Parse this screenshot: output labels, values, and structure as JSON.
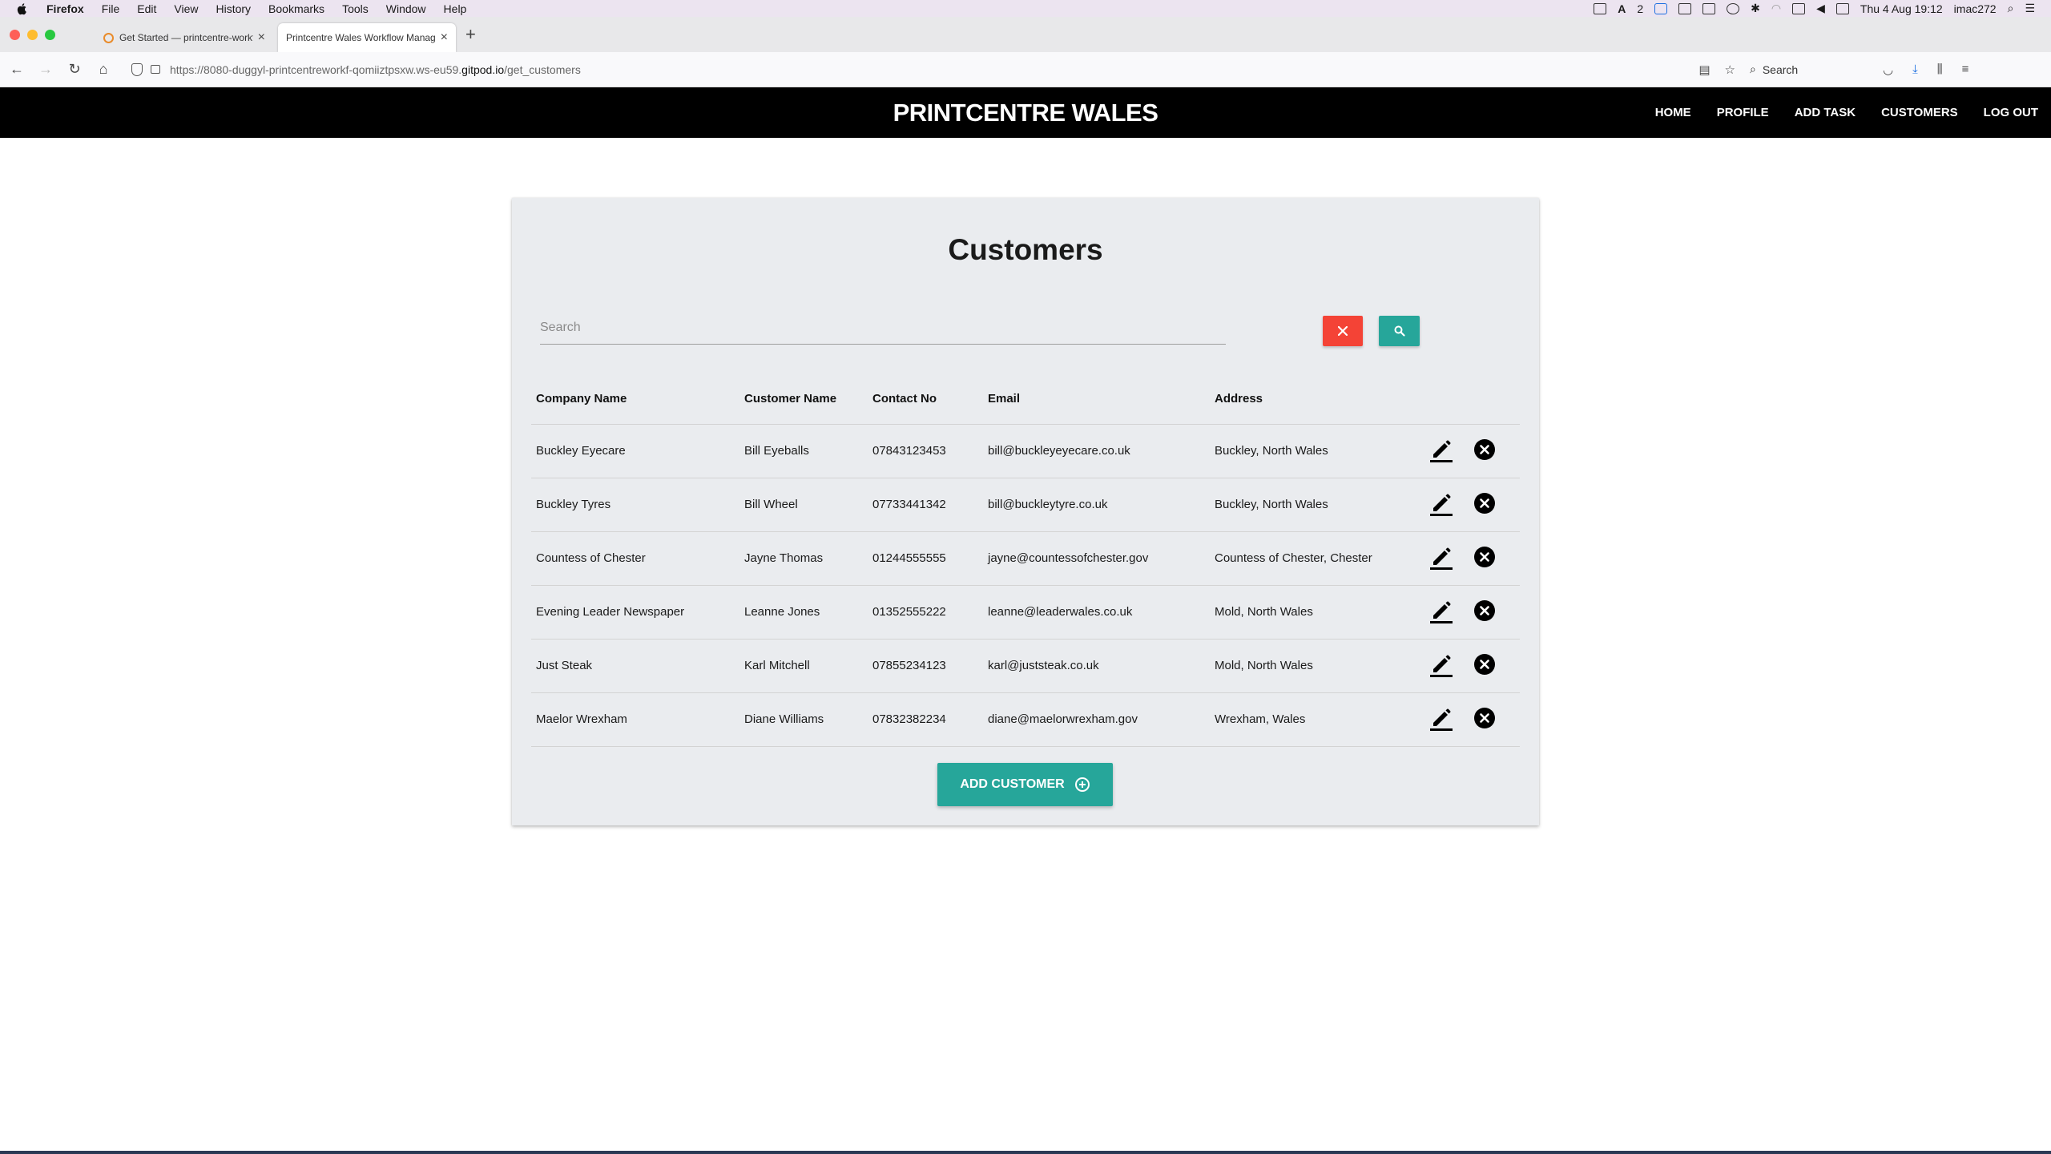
{
  "os_menubar": {
    "menus": [
      "Firefox",
      "File",
      "Edit",
      "View",
      "History",
      "Bookmarks",
      "Tools",
      "Window",
      "Help"
    ],
    "badge_count": "2",
    "clock": "Thu 4 Aug  19:12",
    "user": "imac272"
  },
  "browser": {
    "tabs": [
      {
        "title": "Get Started — printcentre-workf",
        "active": false
      },
      {
        "title": "Printcentre Wales Workflow Manager",
        "active": true
      }
    ],
    "url": {
      "prefix": "https://8080-duggyl-printcentreworkf-qomiiztpsxw.ws-eu59.",
      "host": "gitpod.io",
      "path": "/get_customers"
    },
    "search_placeholder": "Search"
  },
  "site": {
    "brand": "PRINTCENTRE WALES",
    "nav": [
      "HOME",
      "PROFILE",
      "ADD TASK",
      "CUSTOMERS",
      "LOG OUT"
    ]
  },
  "page": {
    "title": "Customers",
    "search_placeholder": "Search",
    "add_button_label": "ADD CUSTOMER"
  },
  "table": {
    "headers": [
      "Company Name",
      "Customer Name",
      "Contact No",
      "Email",
      "Address"
    ],
    "rows": [
      [
        "Buckley Eyecare",
        "Bill Eyeballs",
        "07843123453",
        "bill@buckleyeyecare.co.uk",
        "Buckley, North Wales"
      ],
      [
        "Buckley Tyres",
        "Bill Wheel",
        "07733441342",
        "bill@buckleytyre.co.uk",
        "Buckley, North Wales"
      ],
      [
        "Countess of Chester",
        "Jayne Thomas",
        "01244555555",
        "jayne@countessofchester.gov",
        "Countess of Chester, Chester"
      ],
      [
        "Evening Leader Newspaper",
        "Leanne Jones",
        "01352555222",
        "leanne@leaderwales.co.uk",
        "Mold, North Wales"
      ],
      [
        "Just Steak",
        "Karl Mitchell",
        "07855234123",
        "karl@juststeak.co.uk",
        "Mold, North Wales"
      ],
      [
        "Maelor Wrexham",
        "Diane Williams",
        "07832382234",
        "diane@maelorwrexham.gov",
        "Wrexham, Wales"
      ]
    ]
  },
  "colors": {
    "header_bg": "#000000",
    "card_bg": "#eaecef",
    "teal": "#26a69a",
    "red": "#f44336"
  }
}
